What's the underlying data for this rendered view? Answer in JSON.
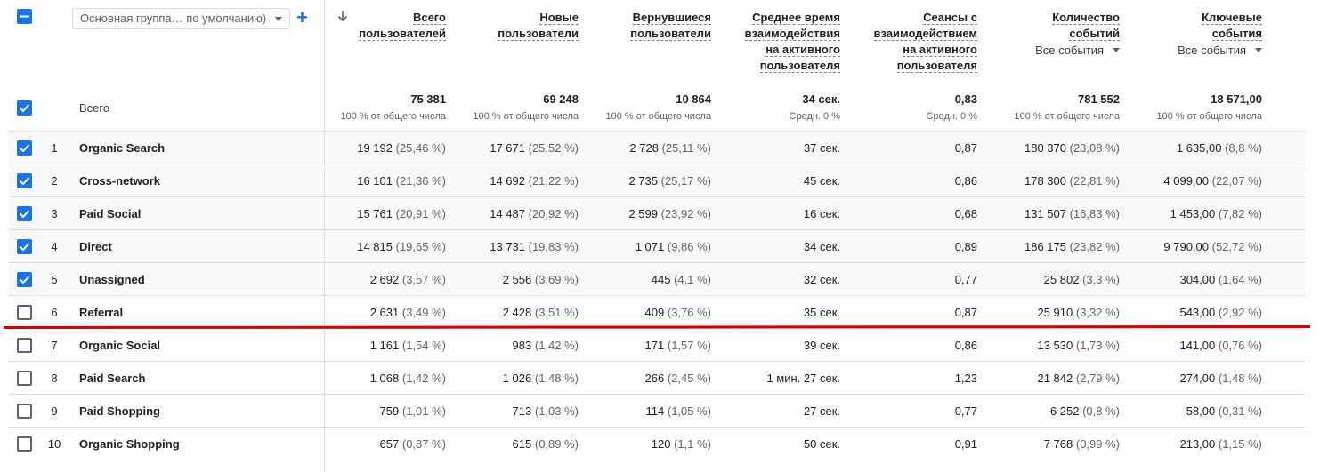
{
  "toolbar": {
    "group_select": "Основная группа… по умолчанию)",
    "add_icon": "plus-icon",
    "sort_icon": "arrow-down-icon"
  },
  "columns": [
    {
      "label_lines": [
        "Всего",
        "пользователей"
      ],
      "total": "75 381",
      "total_sub": "100 % от общего числа"
    },
    {
      "label_lines": [
        "Новые",
        "пользователи"
      ],
      "total": "69 248",
      "total_sub": "100 % от общего числа"
    },
    {
      "label_lines": [
        "Вернувшиеся",
        "пользователи"
      ],
      "total": "10 864",
      "total_sub": "100 % от общего числа"
    },
    {
      "label_lines": [
        "Среднее время",
        "взаимодействия",
        "на активного",
        "пользователя"
      ],
      "total": "34 сек.",
      "total_sub": "Средн. 0 %"
    },
    {
      "label_lines": [
        "Сеансы с",
        "взаимодействием",
        "на активного",
        "пользователя"
      ],
      "total": "0,83",
      "total_sub": "Средн. 0 %"
    },
    {
      "label_lines": [
        "Количество",
        "событий"
      ],
      "filter": "Все события",
      "total": "781 552",
      "total_sub": "100 % от общего числа"
    },
    {
      "label_lines": [
        "Ключевые",
        "события"
      ],
      "filter": "Все события",
      "total": "18 571,00",
      "total_sub": "100 % от общего числа"
    }
  ],
  "total_row_label": "Всего",
  "rows": [
    {
      "rank": "1",
      "name": "Organic Search",
      "checked": true,
      "cells": [
        [
          "19 192",
          "(25,46 %)"
        ],
        [
          "17 671",
          "(25,52 %)"
        ],
        [
          "2 728",
          "(25,11 %)"
        ],
        [
          "37 сек.",
          ""
        ],
        [
          "0,87",
          ""
        ],
        [
          "180 370",
          "(23,08 %)"
        ],
        [
          "1 635,00",
          "(8,8 %)"
        ]
      ]
    },
    {
      "rank": "2",
      "name": "Cross-network",
      "checked": true,
      "cells": [
        [
          "16 101",
          "(21,36 %)"
        ],
        [
          "14 692",
          "(21,22 %)"
        ],
        [
          "2 735",
          "(25,17 %)"
        ],
        [
          "45 сек.",
          ""
        ],
        [
          "0,86",
          ""
        ],
        [
          "178 300",
          "(22,81 %)"
        ],
        [
          "4 099,00",
          "(22,07 %)"
        ]
      ]
    },
    {
      "rank": "3",
      "name": "Paid Social",
      "checked": true,
      "cells": [
        [
          "15 761",
          "(20,91 %)"
        ],
        [
          "14 487",
          "(20,92 %)"
        ],
        [
          "2 599",
          "(23,92 %)"
        ],
        [
          "16 сек.",
          ""
        ],
        [
          "0,68",
          ""
        ],
        [
          "131 507",
          "(16,83 %)"
        ],
        [
          "1 453,00",
          "(7,82 %)"
        ]
      ]
    },
    {
      "rank": "4",
      "name": "Direct",
      "checked": true,
      "cells": [
        [
          "14 815",
          "(19,65 %)"
        ],
        [
          "13 731",
          "(19,83 %)"
        ],
        [
          "1 071",
          "(9,86 %)"
        ],
        [
          "34 сек.",
          ""
        ],
        [
          "0,89",
          ""
        ],
        [
          "186 175",
          "(23,82 %)"
        ],
        [
          "9 790,00",
          "(52,72 %)"
        ]
      ]
    },
    {
      "rank": "5",
      "name": "Unassigned",
      "checked": true,
      "cells": [
        [
          "2 692",
          "(3,57 %)"
        ],
        [
          "2 556",
          "(3,69 %)"
        ],
        [
          "445",
          "(4,1 %)"
        ],
        [
          "32 сек.",
          ""
        ],
        [
          "0,77",
          ""
        ],
        [
          "25 802",
          "(3,3 %)"
        ],
        [
          "304,00",
          "(1,64 %)"
        ]
      ]
    },
    {
      "rank": "6",
      "name": "Referral",
      "checked": false,
      "cells": [
        [
          "2 631",
          "(3,49 %)"
        ],
        [
          "2 428",
          "(3,51 %)"
        ],
        [
          "409",
          "(3,76 %)"
        ],
        [
          "35 сек.",
          ""
        ],
        [
          "0,87",
          ""
        ],
        [
          "25 910",
          "(3,32 %)"
        ],
        [
          "543,00",
          "(2,92 %)"
        ]
      ]
    },
    {
      "rank": "7",
      "name": "Organic Social",
      "checked": false,
      "cells": [
        [
          "1 161",
          "(1,54 %)"
        ],
        [
          "983",
          "(1,42 %)"
        ],
        [
          "171",
          "(1,57 %)"
        ],
        [
          "39 сек.",
          ""
        ],
        [
          "0,86",
          ""
        ],
        [
          "13 530",
          "(1,73 %)"
        ],
        [
          "141,00",
          "(0,76 %)"
        ]
      ]
    },
    {
      "rank": "8",
      "name": "Paid Search",
      "checked": false,
      "cells": [
        [
          "1 068",
          "(1,42 %)"
        ],
        [
          "1 026",
          "(1,48 %)"
        ],
        [
          "266",
          "(2,45 %)"
        ],
        [
          "1 мин. 27 сек.",
          ""
        ],
        [
          "1,23",
          ""
        ],
        [
          "21 842",
          "(2,79 %)"
        ],
        [
          "274,00",
          "(1,48 %)"
        ]
      ]
    },
    {
      "rank": "9",
      "name": "Paid Shopping",
      "checked": false,
      "cells": [
        [
          "759",
          "(1,01 %)"
        ],
        [
          "713",
          "(1,03 %)"
        ],
        [
          "114",
          "(1,05 %)"
        ],
        [
          "27 сек.",
          ""
        ],
        [
          "0,77",
          ""
        ],
        [
          "6 252",
          "(0,8 %)"
        ],
        [
          "58,00",
          "(0,31 %)"
        ]
      ]
    },
    {
      "rank": "10",
      "name": "Organic Shopping",
      "checked": false,
      "cells": [
        [
          "657",
          "(0,87 %)"
        ],
        [
          "615",
          "(0,89 %)"
        ],
        [
          "120",
          "(1,1 %)"
        ],
        [
          "50 сек.",
          ""
        ],
        [
          "0,91",
          ""
        ],
        [
          "7 768",
          "(0,99 %)"
        ],
        [
          "213,00",
          "(1,15 %)"
        ]
      ]
    }
  ],
  "colors": {
    "accent": "#1a73e8",
    "annotation": "#d50000",
    "border": "#dadce0"
  }
}
